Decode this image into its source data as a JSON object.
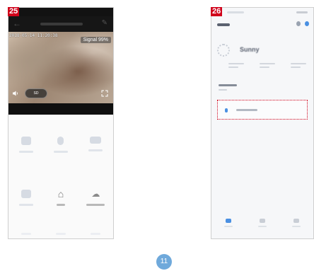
{
  "steps": {
    "left": "25",
    "right": "26"
  },
  "camera_screen": {
    "timestamp": "2018-05-14 11:20:38",
    "signal": "Signal 99%",
    "sd_label": "SD"
  },
  "home_screen": {
    "home_name": "Sunny"
  },
  "colors": {
    "step_badge": "#d0021b",
    "highlight_border": "#d0021b",
    "accent": "#4a90e2",
    "page_number_bg": "#6fa9db"
  },
  "page_number": "11"
}
